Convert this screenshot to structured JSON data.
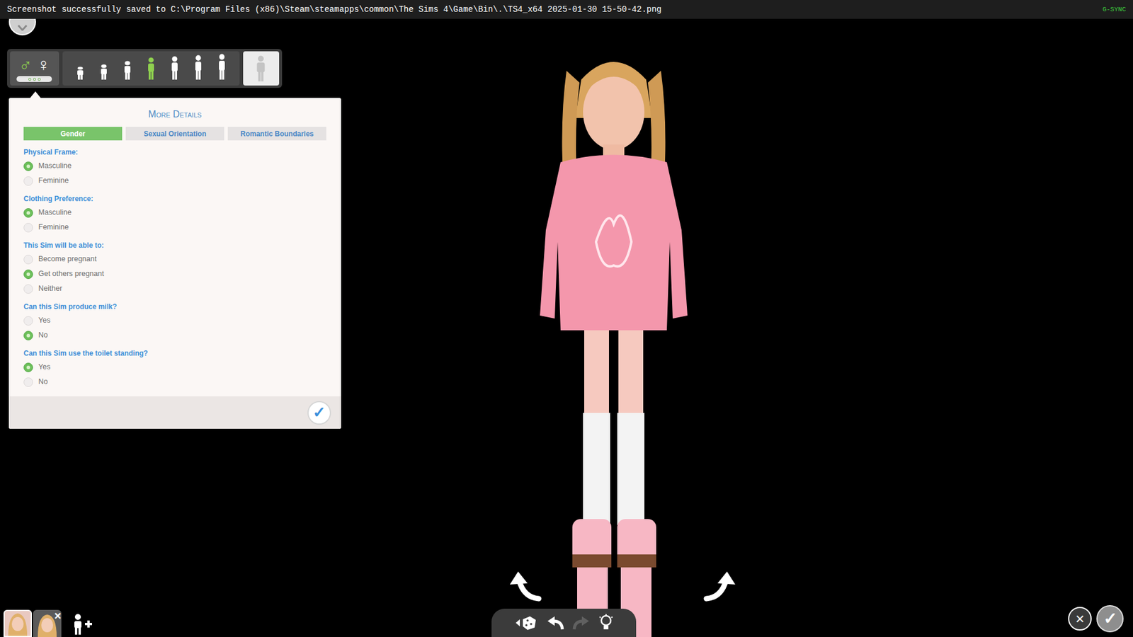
{
  "notification": {
    "text": "Screenshot successfully saved to C:\\Program Files (x86)\\Steam\\steamapps\\common\\The Sims 4\\Game\\Bin\\.\\TS4_x64 2025-01-30 15-50-42.png",
    "sync": "G-SYNC"
  },
  "gender_buttons": [
    {
      "symbol": "♂",
      "selected": true
    },
    {
      "symbol": "♀",
      "selected": false
    }
  ],
  "age_buttons": [
    {
      "selected": false
    },
    {
      "selected": false
    },
    {
      "selected": false
    },
    {
      "selected": true
    },
    {
      "selected": false
    },
    {
      "selected": false
    },
    {
      "selected": false
    }
  ],
  "more_details": {
    "title": "More Details",
    "tabs": [
      {
        "label": "Gender",
        "selected": true
      },
      {
        "label": "Sexual Orientation",
        "selected": false
      },
      {
        "label": "Romantic Boundaries",
        "selected": false
      }
    ],
    "groups": [
      {
        "label": "Physical Frame:",
        "options": [
          {
            "label": "Masculine",
            "selected": true
          },
          {
            "label": "Feminine",
            "selected": false
          }
        ]
      },
      {
        "label": "Clothing Preference:",
        "options": [
          {
            "label": "Masculine",
            "selected": true
          },
          {
            "label": "Feminine",
            "selected": false
          }
        ]
      },
      {
        "label": "This Sim will be able to:",
        "options": [
          {
            "label": "Become pregnant",
            "selected": false
          },
          {
            "label": "Get others pregnant",
            "selected": true
          },
          {
            "label": "Neither",
            "selected": false
          }
        ]
      },
      {
        "label": "Can this Sim produce milk?",
        "options": [
          {
            "label": "Yes",
            "selected": false
          },
          {
            "label": "No",
            "selected": true
          }
        ]
      },
      {
        "label": "Can this Sim use the toilet standing?",
        "options": [
          {
            "label": "Yes",
            "selected": true
          },
          {
            "label": "No",
            "selected": false
          }
        ]
      }
    ],
    "confirm": "✓"
  },
  "household": {
    "sims": [
      {
        "selected": true
      },
      {
        "selected": false
      }
    ],
    "remove": "×"
  },
  "toolbar": [
    {
      "kind": "randomize",
      "disabled": false
    },
    {
      "kind": "undo",
      "disabled": false
    },
    {
      "kind": "redo",
      "disabled": true
    },
    {
      "kind": "hint",
      "disabled": false
    }
  ],
  "cancel": "×",
  "done": "✓"
}
